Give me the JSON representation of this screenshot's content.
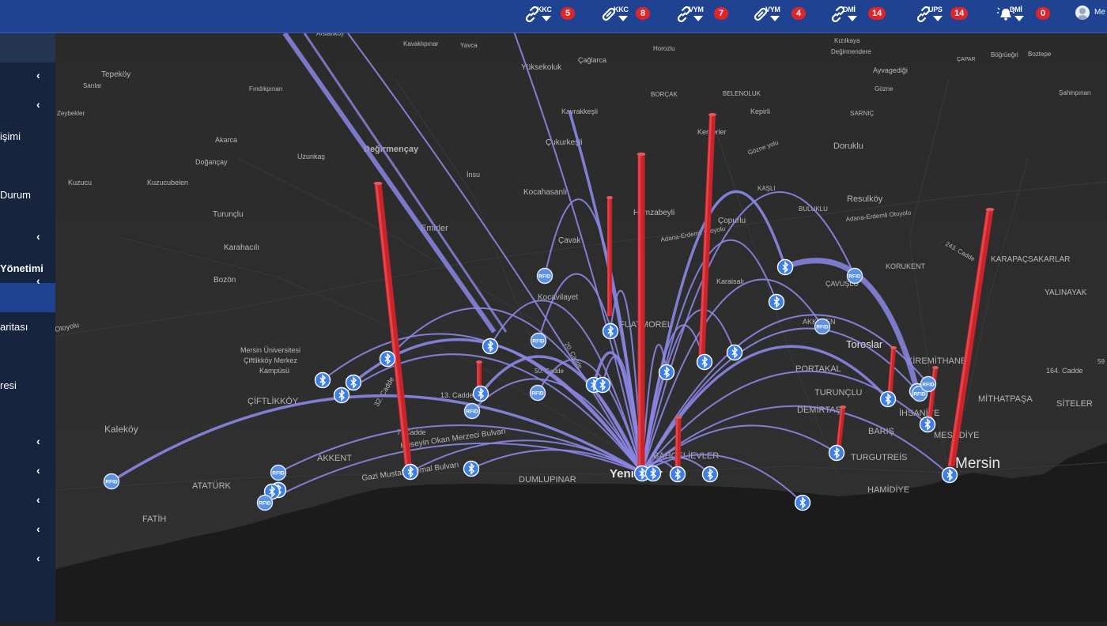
{
  "header": {
    "groups": [
      {
        "label": "KKC",
        "count": "5",
        "icon": "broken-link-icon"
      },
      {
        "label": "KKC",
        "count": "8",
        "icon": "link-icon"
      },
      {
        "label": "VYM",
        "count": "7",
        "icon": "broken-link-icon"
      },
      {
        "label": "VYM",
        "count": "4",
        "icon": "link-icon"
      },
      {
        "label": "DMİ",
        "count": "14",
        "icon": "broken-link-icon"
      },
      {
        "label": "UPS",
        "count": "14",
        "icon": "broken-link-icon"
      },
      {
        "label": "DMİ",
        "count": "0",
        "icon": "alarm-bell-icon"
      }
    ],
    "user_name": "Me"
  },
  "sidebar": {
    "labels": [
      "işimi",
      "Durum",
      "Yönetimi",
      "aritası",
      "resi"
    ]
  },
  "map": {
    "places": {
      "tepekoy": "Tepeköy",
      "sarilar": "Sarılar",
      "zeybekler": "Zeybekler",
      "findikpinari": "Fındıkpınarı",
      "kuzucu": "Kuzucu",
      "kuzucubelen": "Kuzucubelen",
      "akarca": "Akarca",
      "doganca": "Doğançay",
      "uzunkas": "Uzunkaş",
      "degirmencay": "Değirmençay",
      "insu": "İnsu",
      "turunclu": "Turunçlu",
      "karahacili": "Karahacılı",
      "bozon": "Bozön",
      "emirler": "Emirler",
      "kaleoy": "Kaleköy",
      "mersin_univ_1": "Mersin Üniversitesi",
      "mersin_univ_2": "Çiftlikköy Merkez",
      "mersin_univ_3": "Kampüsü",
      "ciftlikkoy": "ÇİFTLİKKÖY",
      "akkent": "AKKENT",
      "ataturk": "ATATÜRK",
      "fatih": "FATİH",
      "otoyolu_w": "Otoyolu",
      "gazi_mustafa": "Gazi Mustafa Kemal Bulvarı",
      "okan_merzeci": "Hüseyin Okan Merzeci Bulvarı",
      "cadde_7": "7. Cadde",
      "cadde_13": "13. Cadde",
      "cadde_32": "32. Cadde",
      "cadde_50": "50. Cadde",
      "kavaklipinar": "Kavaklıpınar",
      "yavca": "Yavca",
      "arslankoy": "Arslanköy",
      "yuksekoluk": "Yüksekoluk",
      "caglarca": "Çağlarca",
      "kayrakkesli": "Kayrakkeşli",
      "cukurkesli": "Çukurkeşli",
      "kocahasanli": "Kocahasanlı",
      "hamzabeyli": "Hamzabeyli",
      "cavak": "Çavak",
      "kocavilayet": "Kocavilayet",
      "fuatmorel": "FUATMOREL",
      "yenisehir": "Yenişehir",
      "ahevler": "BAHÇELİEVLER",
      "dumlupinar": "DUMLUPINAR",
      "kemerler": "Kemerler",
      "horozlu": "Horozlu",
      "borcak": "BORÇAK",
      "belenoluk": "BELENOLUK",
      "kepirli": "Kepirli",
      "gozne_yolu": "Gözne yolu",
      "doruklu": "Doruklu",
      "kasli": "KAŞLI",
      "copurlu": "Çopurlu",
      "adana_erdemli_1": "Adana-Erdemli Otoyolu",
      "adana_erdemli_2": "Adana-Erdemli Otoyolu",
      "resulkoy": "Resulköy",
      "buluklu": "BULUKLU",
      "karaisali": "Karaisalı",
      "cavuslu": "ÇAVUŞLU",
      "akkelen": "AKKELEN",
      "portakal": "PORTAKAL",
      "turunclu2": "TURUNÇLU",
      "demirtas": "DEMİRTAŞ",
      "toroslar": "Toroslar",
      "baris": "BARIŞ",
      "tugrutreis": "TURGUTREİS",
      "hamidiye": "HAMİDİYE",
      "ihsaniye": "İHSANİYE",
      "mesudiye": "MESUDİYE",
      "kiremithane": "KİREMİTHANE",
      "mithatpasa": "MİTHATPAŞA",
      "siteler": "SİTELER",
      "mersin": "Mersin",
      "kizilkaya": "Kızılkaya",
      "degirmendere": "Değirmendere",
      "ayvagedigi": "Ayvagediği",
      "gozne": "Gözne",
      "sarnic": "SARNIÇ",
      "capar": "ÇAPAR",
      "bogrugeri": "Böğrüeğri",
      "boztepe": "Boztepe",
      "sahinpinari": "Şahinpınarı",
      "korukent": "KORUKENT",
      "karapacsakarlar": "KARAPAÇSAKARLAR",
      "yalinayak": "YALINAYAK",
      "cadde_243": "243. Cadde",
      "cadde_164": "164. Cadde",
      "cadde_20": "20. Cadde",
      "cadde_59": "59"
    },
    "hub_name": "Yenişehir",
    "markers": {
      "bluetooth_icon": "bluetooth-icon",
      "rfid_icon": "rfid-icon",
      "rfid_text": "RFID"
    },
    "colors": {
      "arc": "#8c87e6",
      "pillar": "#c9242a",
      "bluetooth": "#3d7fe8",
      "rfid": "#5b93e0",
      "land": "#2e2e2e",
      "sea": "#1b1b1b"
    }
  }
}
